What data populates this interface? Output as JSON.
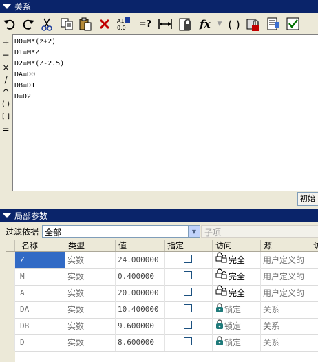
{
  "relations": {
    "title": "关系",
    "toolbar_icons": [
      "undo-icon",
      "redo-icon",
      "cut-icon",
      "copy-icon",
      "paste-icon",
      "delete-icon",
      "sort-icon",
      "evaluate-icon",
      "measure-icon",
      "lock-file-icon",
      "function-icon",
      "parentheses-icon",
      "param-lock-icon",
      "list-icon",
      "verify-icon"
    ],
    "toolbar_labels": {
      "sort_top": "A1",
      "sort_bottom": "0.0",
      "evaluate": "=?",
      "fx": "fx",
      "parens": "( )"
    },
    "operators": [
      "+",
      "−",
      "×",
      "/",
      "^",
      "( )",
      "[ ]",
      "="
    ],
    "lines": [
      "D0=M*(z+2)",
      "D1=M*Z",
      "D2=M*(Z-2.5)",
      "DA=D0",
      "DB=D1",
      "D=D2"
    ],
    "initial_button": "初始"
  },
  "params": {
    "title": "局部参数",
    "filter_label": "过滤依据",
    "filter_value": "全部",
    "sub_item": "子项",
    "columns": [
      "名称",
      "类型",
      "值",
      "指定",
      "访问",
      "源",
      "访"
    ],
    "rows": [
      {
        "name": "Z",
        "type": "实数",
        "value": "24.000000",
        "access": "完全",
        "source": "用户定义的",
        "locked": false
      },
      {
        "name": "M",
        "type": "实数",
        "value": "0.400000",
        "access": "完全",
        "source": "用户定义的",
        "locked": false
      },
      {
        "name": "A",
        "type": "实数",
        "value": "20.000000",
        "access": "完全",
        "source": "用户定义的",
        "locked": false
      },
      {
        "name": "DA",
        "type": "实数",
        "value": "10.400000",
        "access": "锁定",
        "source": "关系",
        "locked": true
      },
      {
        "name": "DB",
        "type": "实数",
        "value": "9.600000",
        "access": "锁定",
        "source": "关系",
        "locked": true
      },
      {
        "name": "D",
        "type": "实数",
        "value": "8.600000",
        "access": "锁定",
        "source": "关系",
        "locked": true
      }
    ]
  },
  "colors": {
    "titlebar": "#0a246a",
    "selection": "#316ac5",
    "background": "#ece9d8"
  }
}
